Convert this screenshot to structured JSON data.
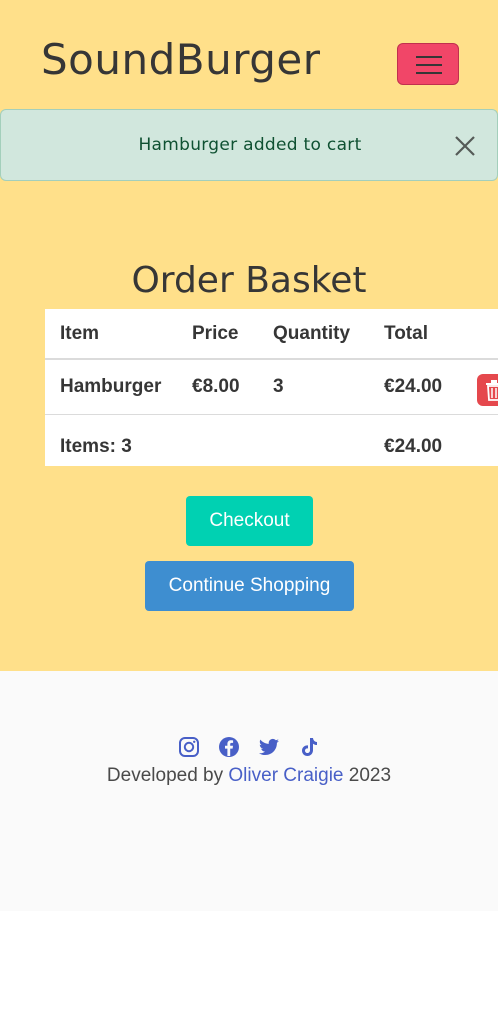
{
  "header": {
    "brand": "SoundBurger",
    "menu_button_icon": "hamburger-menu-icon",
    "menu_button_color": "#f14668"
  },
  "alert": {
    "message": "Hamburger added to cart",
    "close_icon": "close-icon",
    "background": "#d1e7dd"
  },
  "basket": {
    "title": "Order Basket",
    "columns": [
      "Item",
      "Price",
      "Quantity",
      "Total"
    ],
    "rows": [
      {
        "item": "Hamburger",
        "price": "€8.00",
        "quantity": "3",
        "total": "€24.00",
        "delete_icon": "trash-icon"
      }
    ],
    "summary": {
      "items_label": "Items: 3",
      "total": "€24.00"
    }
  },
  "actions": {
    "checkout_label": "Checkout",
    "continue_label": "Continue Shopping",
    "checkout_color": "#00d1b2",
    "continue_color": "#3e8ed0"
  },
  "footer": {
    "social_icons": [
      "instagram-icon",
      "facebook-icon",
      "twitter-icon",
      "tiktok-icon"
    ],
    "credit_prefix": "Developed by",
    "credit_name": "Oliver Craigie",
    "credit_year": "2023",
    "link_color": "#485fc7"
  }
}
